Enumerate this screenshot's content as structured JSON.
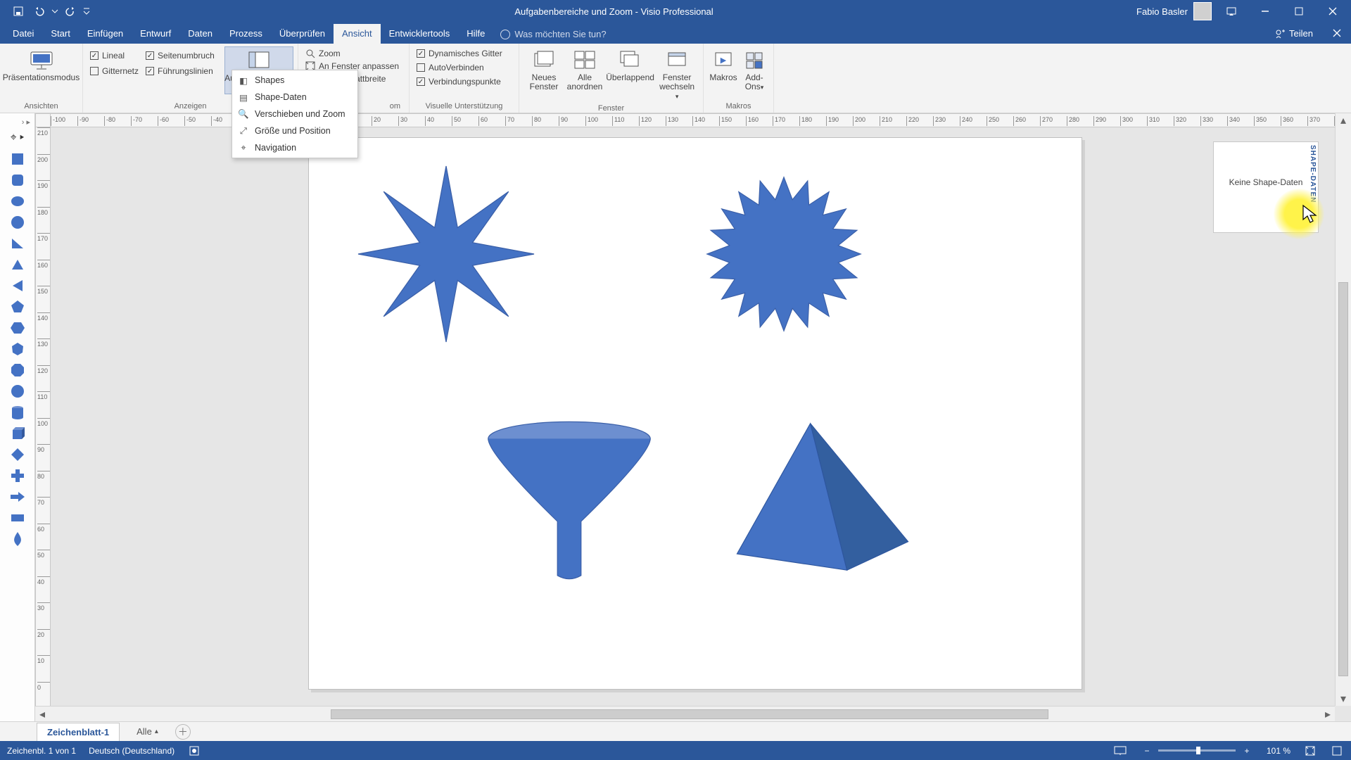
{
  "colors": {
    "brand": "#2b579a",
    "shapeFill": "#4472c4"
  },
  "title": "Aufgabenbereiche und Zoom  -  Visio Professional",
  "user": "Fabio Basler",
  "tabs": {
    "file": "Datei",
    "items": [
      "Start",
      "Einfügen",
      "Entwurf",
      "Daten",
      "Prozess",
      "Überprüfen",
      "Ansicht",
      "Entwicklertools",
      "Hilfe"
    ],
    "activeIndex": 6,
    "tellme": "Was möchten Sie tun?",
    "share": "Teilen"
  },
  "ribbon": {
    "g_views": {
      "label": "Ansichten",
      "presentation": "Präsentationsmodus"
    },
    "g_show": {
      "label": "Anzeigen",
      "chk": {
        "lineal": "Lineal",
        "seitenu": "Seitenumbruch",
        "gitter": "Gitternetz",
        "fuehrung": "Führungslinien"
      },
      "panes": "Aufgabenbereiche"
    },
    "g_zoom": {
      "label": "om",
      "zoom": "Zoom",
      "fit": "An Fenster anpassen",
      "width": "Zeichenblattbreite"
    },
    "g_vis": {
      "label": "Visuelle Unterstützung",
      "dyn": "Dynamisches Gitter",
      "auto": "AutoVerbinden",
      "conn": "Verbindungspunkte"
    },
    "g_window": {
      "label": "Fenster",
      "new": "Neues\nFenster",
      "arrange": "Alle\nanordnen",
      "cascade": "Überlappend",
      "switch": "Fenster\nwechseln"
    },
    "g_macros": {
      "label": "Makros",
      "macros": "Makros",
      "addons": "Add-\nOns"
    }
  },
  "dropdown": {
    "shapes": "Shapes",
    "shapedata": "Shape-Daten",
    "panzoom": "Verschieben und Zoom",
    "sizepos": "Größe und Position",
    "nav": "Navigation"
  },
  "shapeDataPane": {
    "title": "SHAPE-DATEN",
    "msg": "Keine Shape-Daten"
  },
  "sheets": {
    "active": "Zeichenblatt-1",
    "all": "Alle"
  },
  "status": {
    "page": "Zeichenbl. 1 von 1",
    "lang": "Deutsch (Deutschland)",
    "zoom": "101 %"
  }
}
